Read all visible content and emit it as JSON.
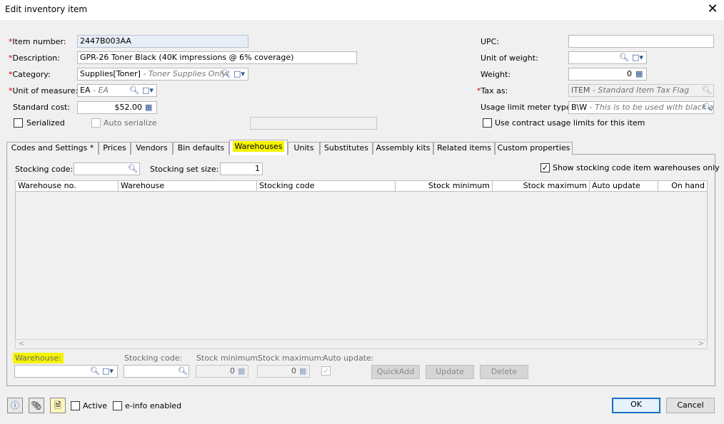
{
  "window": {
    "title": "Edit inventory item",
    "close_glyph": "✕"
  },
  "form": {
    "item_number": {
      "label": "Item number:",
      "value": "2447B003AA"
    },
    "description": {
      "label": "Description:",
      "value": "GPR-26 Toner Black (40K impressions @ 6% coverage)"
    },
    "category": {
      "label": "Category:",
      "value": "Supplies[Toner]",
      "hint": " - Toner Supplies Only!"
    },
    "unit_of_measure": {
      "label": "Unit of measure:",
      "value": "EA",
      "hint": " - EA"
    },
    "standard_cost": {
      "label": "Standard cost:",
      "value": "$52.00"
    },
    "serialized": {
      "label": "Serialized",
      "checked": false
    },
    "auto_serialize": {
      "label": "Auto serialize",
      "checked": false
    },
    "upc": {
      "label": "UPC:",
      "value": ""
    },
    "unit_of_weight": {
      "label": "Unit of weight:",
      "value": ""
    },
    "weight": {
      "label": "Weight:",
      "value": "0"
    },
    "tax_as": {
      "label": "Tax as:",
      "value": "ITEM",
      "hint": " - Standard Item Tax Flag"
    },
    "usage_limit": {
      "label": "Usage limit meter type:",
      "value": "B\\W",
      "hint": " - This is to be used with black and"
    },
    "contract_usage": {
      "label": "Use contract usage limits for this item",
      "checked": false
    },
    "required_marker": "*"
  },
  "tabs": [
    {
      "label": "Codes and Settings  *"
    },
    {
      "label": "Prices"
    },
    {
      "label": "Vendors"
    },
    {
      "label": "Bin defaults"
    },
    {
      "label": "Warehouses",
      "active": true
    },
    {
      "label": "Units"
    },
    {
      "label": "Substitutes"
    },
    {
      "label": "Assembly kits"
    },
    {
      "label": "Related items"
    },
    {
      "label": "Custom properties"
    }
  ],
  "warehouses": {
    "stocking_code": {
      "label": "Stocking code:",
      "value": ""
    },
    "stocking_set_size": {
      "label": "Stocking set size:",
      "value": "1"
    },
    "show_only": {
      "label": "Show stocking code item warehouses only",
      "checked": true
    },
    "columns": [
      "Warehouse no.",
      "Warehouse",
      "Stocking code",
      "Stock minimum",
      "Stock maximum",
      "Auto update",
      "On hand"
    ],
    "rows": [],
    "editor": {
      "warehouse": {
        "label": "Warehouse:",
        "value": ""
      },
      "stocking_code": {
        "label": "Stocking code:",
        "value": ""
      },
      "stock_minimum": {
        "label": "Stock minimum:",
        "value": "0"
      },
      "stock_maximum": {
        "label": "Stock maximum:",
        "value": "0"
      },
      "auto_update": {
        "label": "Auto update:",
        "checked": true
      },
      "quickadd_label": "QuickAdd",
      "update_label": "Update",
      "delete_label": "Delete"
    }
  },
  "footer": {
    "active": {
      "label": "Active",
      "checked": false
    },
    "einfo": {
      "label": "e-info enabled",
      "checked": false
    },
    "ok_label": "OK",
    "cancel_label": "Cancel"
  },
  "colors": {
    "highlight": "#f4f400",
    "required": "#d00000",
    "ok_border": "#1a6fc9"
  },
  "icons": [
    "search-icon",
    "dropdown-icon",
    "calendar-icon",
    "info-icon",
    "attach-icon",
    "note-icon",
    "close-icon",
    "check-icon"
  ]
}
